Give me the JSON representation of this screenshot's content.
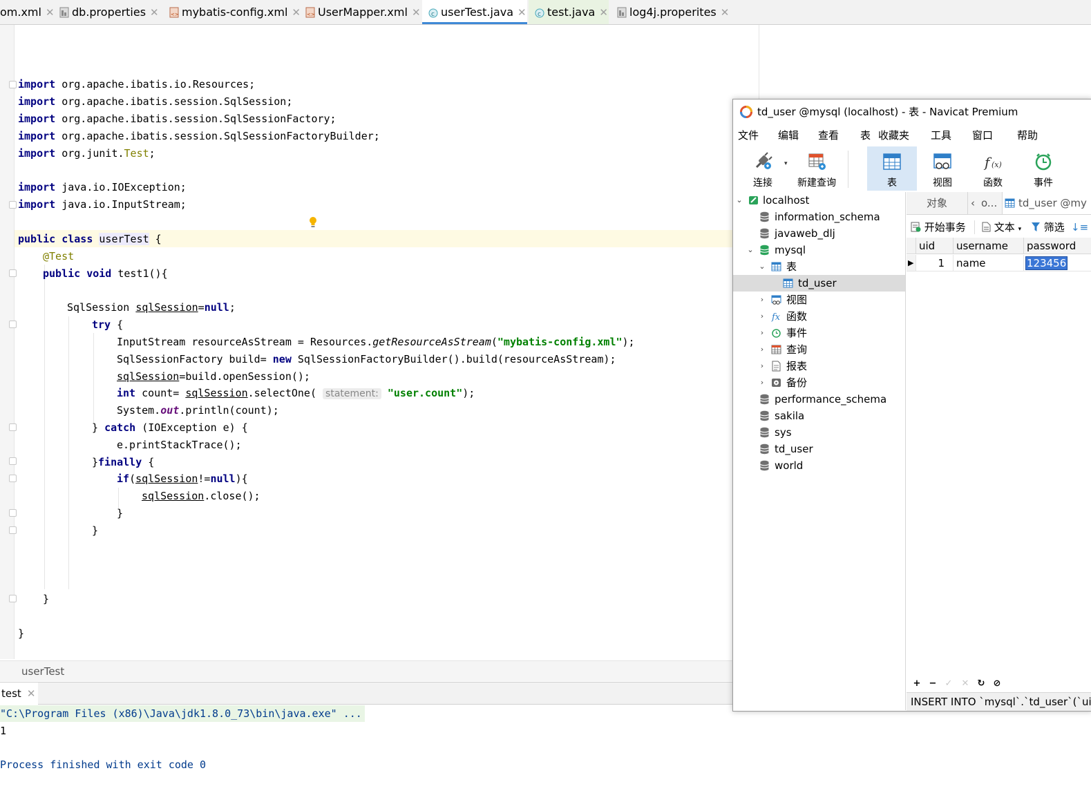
{
  "ide": {
    "tabs": [
      {
        "label": "om.xml"
      },
      {
        "label": "db.properties"
      },
      {
        "label": "mybatis-config.xml"
      },
      {
        "label": "UserMapper.xml"
      },
      {
        "label": "userTest.java"
      },
      {
        "label": "test.java"
      },
      {
        "label": "log4j.properites"
      }
    ],
    "active_tab": "userTest.java",
    "code": {
      "import1": "org.apache.ibatis.io.Resources;",
      "import2": "org.apache.ibatis.session.SqlSession;",
      "import3": "org.apache.ibatis.session.SqlSessionFactory;",
      "import4": "org.apache.ibatis.session.SqlSessionFactoryBuilder;",
      "import5_pkg": "org.junit.",
      "import5_cls": "Test",
      "import6": "java.io.IOException;",
      "import7": "java.io.InputStream;",
      "kw_import": "import",
      "kw_public": "public",
      "kw_class": "class",
      "kw_void": "void",
      "kw_null": "null",
      "kw_try": "try",
      "kw_new": "new",
      "kw_int": "int",
      "kw_catch": "catch",
      "kw_finally": "finally",
      "kw_if": "if",
      "class_name": "userTest",
      "annotation": "@Test",
      "method": "test1(){",
      "sqlsession_decl": "SqlSession ",
      "var_sqlsession": "sqlSession",
      "stream_decl": "InputStream resourceAsStream = Resources.",
      "get_resource": "getResourceAsStream",
      "config_str": "\"mybatis-config.xml\"",
      "factory_decl": "SqlSessionFactory build= ",
      "factory_new": "SqlSessionFactoryBuilder().build(resourceAsStream);",
      "open_session": "=build.openSession();",
      "count_decl": " count= ",
      "select_one": ".selectOne(",
      "param_hint": "statement:",
      "count_str": "\"user.count\"",
      "println_pre": "System.",
      "println_out": "out",
      "println_post": ".println(count);",
      "catch_args": "(IOException e) {",
      "print_trace": "e.printStackTrace();",
      "not_null": "!=",
      "close_call": ".close();"
    },
    "breadcrumb": "userTest",
    "run_tab": "test",
    "console": {
      "line1": "\"C:\\Program Files (x86)\\Java\\jdk1.8.0_73\\bin\\java.exe\" ...",
      "line2": "1",
      "line3": "Process finished with exit code 0"
    }
  },
  "navicat": {
    "title": "td_user @mysql (localhost) - 表 - Navicat Premium",
    "menu": [
      "文件",
      "编辑",
      "查看",
      "表",
      "收藏夹",
      "工具",
      "窗口",
      "帮助"
    ],
    "toolbar": [
      {
        "label": "连接",
        "icon": "plug-icon"
      },
      {
        "label": "新建查询",
        "icon": "new-query-icon"
      },
      {
        "label": "表",
        "icon": "table-icon"
      },
      {
        "label": "视图",
        "icon": "view-icon"
      },
      {
        "label": "函数",
        "icon": "function-icon"
      },
      {
        "label": "事件",
        "icon": "clock-icon"
      }
    ],
    "tree": {
      "connection": "localhost",
      "databases_top": [
        "information_schema",
        "javaweb_dlj"
      ],
      "open_db": "mysql",
      "tables_folder": "表",
      "selected_table": "td_user",
      "folders": [
        "视图",
        "函数",
        "事件",
        "查询",
        "报表",
        "备份"
      ],
      "databases_bottom": [
        "performance_schema",
        "sakila",
        "sys",
        "td_user",
        "world"
      ]
    },
    "object_tab": "对象",
    "object_tab2": "o...",
    "object_tab3": "td_user @my",
    "row_tools": {
      "begin_tx": "开始事务",
      "text": "文本",
      "filter": "筛选"
    },
    "grid": {
      "columns": [
        "uid",
        "username",
        "password"
      ],
      "rows": [
        [
          "1",
          "name",
          "123456"
        ]
      ]
    },
    "sql_status": "INSERT INTO `mysql`.`td_user`(`uid`"
  },
  "colors": {
    "keyword": "#000080",
    "string": "#008000",
    "annotation": "#808000",
    "tab_active_underline": "#3f89d6",
    "selection": "#3a76d6"
  }
}
